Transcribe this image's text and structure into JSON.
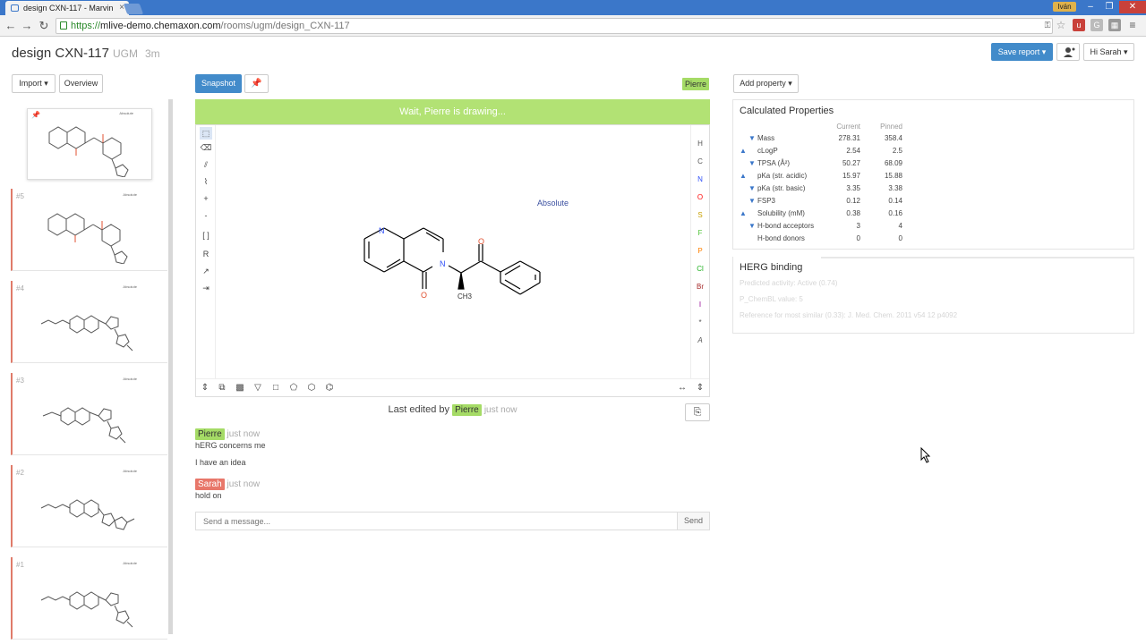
{
  "browser": {
    "tab_title": "design CXN-117 - Marvin",
    "url_protocol": "https://",
    "url_host": "mlive-demo.chemaxon.com",
    "url_path": "/rooms/ugm/design_CXN-117",
    "os_user": "Iván"
  },
  "header": {
    "title": "design CXN-117",
    "room": "UGM",
    "age": "3m",
    "save_report": "Save report",
    "greeting": "Hi Sarah"
  },
  "left": {
    "import_label": "Import",
    "overview_label": "Overview",
    "snapshots": [
      {
        "num": "#5",
        "tag": "Absolute"
      },
      {
        "num": "#4",
        "tag": "Absolute"
      },
      {
        "num": "#3",
        "tag": "Absolute"
      },
      {
        "num": "#2",
        "tag": "Absolute"
      },
      {
        "num": "#1",
        "tag": "Absolute"
      }
    ],
    "current_tag": "Absolute"
  },
  "editor": {
    "snapshot_label": "Snapshot",
    "drawing_user": "Pierre",
    "banner": "Wait, Pierre is drawing...",
    "absolute_label": "Absolute",
    "elements": [
      "H",
      "C",
      "N",
      "O",
      "S",
      "F",
      "P",
      "Cl",
      "Br",
      "I",
      "*",
      "A"
    ],
    "element_colors": {
      "H": "#555555",
      "C": "#555555",
      "N": "#3050f8",
      "O": "#ff0d0d",
      "S": "#c8a000",
      "F": "#52c43a",
      "P": "#ff8000",
      "Cl": "#1ff01f",
      "Br": "#a62929",
      "I": "#940094"
    },
    "atoms": {
      "N1": "N",
      "N2": "N",
      "O1": "O",
      "O2": "O",
      "CH3": "CH3"
    },
    "last_edited_prefix": "Last edited by",
    "last_edited_user": "Pierre",
    "last_edited_time": "just now"
  },
  "chat": {
    "messages": [
      {
        "user": "Pierre",
        "time": "just now",
        "lines": [
          "hERG concerns me",
          "I have an idea"
        ]
      },
      {
        "user": "Sarah",
        "time": "just now",
        "lines": [
          "hold on"
        ]
      }
    ],
    "input_placeholder": "Send a message...",
    "send_label": "Send"
  },
  "properties": {
    "add_property_label": "Add property",
    "title": "Calculated Properties",
    "col_current": "Current",
    "col_pinned": "Pinned",
    "rows": [
      {
        "name": "Mass",
        "current": "278.31",
        "pinned": "358.4",
        "trend": "down",
        "indent": 1
      },
      {
        "name": "cLogP",
        "current": "2.54",
        "pinned": "2.5",
        "trend": "up",
        "indent": 0
      },
      {
        "name": "TPSA (Å²)",
        "current": "50.27",
        "pinned": "68.09",
        "trend": "down",
        "indent": 1
      },
      {
        "name": "pKa (str. acidic)",
        "current": "15.97",
        "pinned": "15.88",
        "trend": "up",
        "indent": 0
      },
      {
        "name": "pKa (str. basic)",
        "current": "3.35",
        "pinned": "3.38",
        "trend": "down",
        "indent": 1
      },
      {
        "name": "FSP3",
        "current": "0.12",
        "pinned": "0.14",
        "trend": "down",
        "indent": 1
      },
      {
        "name": "Solubility (mM)",
        "current": "0.38",
        "pinned": "0.16",
        "trend": "up",
        "indent": 0
      },
      {
        "name": "H-bond acceptors",
        "current": "3",
        "pinned": "4",
        "trend": "down",
        "indent": 1
      },
      {
        "name": "H-bond donors",
        "current": "0",
        "pinned": "0",
        "trend": "none",
        "indent": 1
      }
    ],
    "herg_title": "HERG binding",
    "herg_lines": [
      "Predicted activity: Active (0.74)",
      "P_ChemBL value: 5",
      "Reference for most similar (0.33): J. Med. Chem. 2011 v54 12 p4092"
    ]
  },
  "colors": {
    "accent": "#428bca",
    "pierre": "#a5db66",
    "sarah": "#e8776a",
    "banner": "#b2e274"
  }
}
